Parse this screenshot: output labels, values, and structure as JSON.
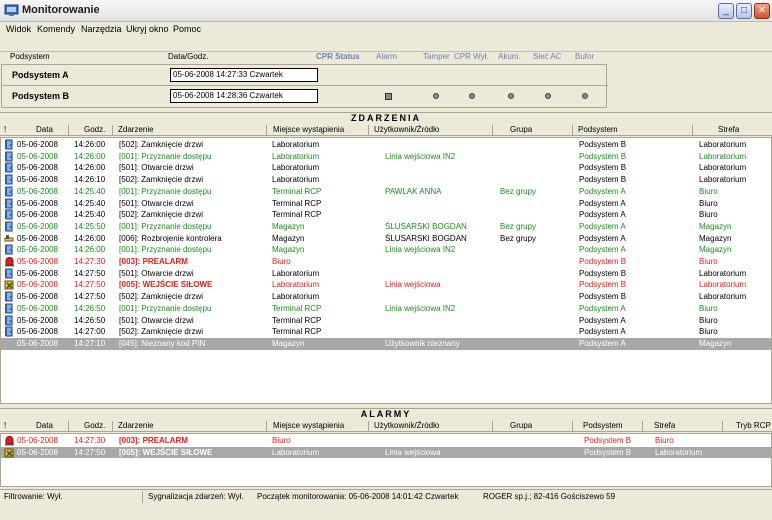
{
  "window": {
    "title": "Monitorowanie",
    "buttons": {
      "minimize": "_",
      "maximize": "□",
      "close": "✕"
    }
  },
  "menu": [
    "Widok",
    "Komendy",
    "Narzędzia",
    "Ukryj okno",
    "Pomoc"
  ],
  "status_header": {
    "podsystem": "Podsystem",
    "datagodz": "Data/Godz.",
    "cpr_status": "CPR Status",
    "alarm": "Alarm",
    "tamper": "Tamper",
    "cpr_wyl": "CPR Wył.",
    "akum": "Akum.",
    "siec_ac": "Sieć AC",
    "bufor": "Bufor"
  },
  "subsystems": [
    {
      "name": "Podsystem A",
      "datetime": "05-06-2008  14:27:33  Czwartek",
      "indicators": false
    },
    {
      "name": "Podsystem B",
      "datetime": "05-06-2008  14:28:36  Czwartek",
      "indicators": true
    }
  ],
  "events": {
    "title": "ZDARZENIA",
    "columns": [
      "Data",
      "Godz.",
      "Zdarzenie",
      "Miejsce wystąpienia",
      "Użytkownik/Źródło",
      "Grupa",
      "Podsystem",
      "Strefa"
    ],
    "colors": {
      "green": "#1e8a1e",
      "red": "#e41b1b",
      "black": "#000000"
    },
    "rows": [
      {
        "icon": "door-icon",
        "color": "black",
        "d": "05-06-2008",
        "t": "14:26:00",
        "e": "[502]: Zamknięcie drzwi",
        "m": "Laboratorium",
        "u": "",
        "g": "",
        "p": "Podsystem B",
        "s": "Laboratorium"
      },
      {
        "icon": "door-icon",
        "color": "green",
        "d": "05-06-2008",
        "t": "14:26:00",
        "e": "[001]: Przyznanie dostępu",
        "m": "Laboratorium",
        "u": "Linia wejściowa IN2",
        "g": "",
        "p": "Podsystem B",
        "s": "Laboratorium"
      },
      {
        "icon": "door-icon",
        "color": "black",
        "d": "05-06-2008",
        "t": "14:26:00",
        "e": "[501]: Otwarcie drzwi",
        "m": "Laboratorium",
        "u": "",
        "g": "",
        "p": "Podsystem B",
        "s": "Laboratorium"
      },
      {
        "icon": "door-icon",
        "color": "black",
        "d": "05-06-2008",
        "t": "14:26:10",
        "e": "[502]: Zamknięcie drzwi",
        "m": "Laboratorium",
        "u": "",
        "g": "",
        "p": "Podsystem B",
        "s": "Laboratorium"
      },
      {
        "icon": "door-icon",
        "color": "green",
        "d": "05-06-2008",
        "t": "14:25:40",
        "e": "[001]: Przyznanie dostępu",
        "m": "Terminal RCP",
        "u": "PAWLAK ANNA",
        "g": "Bez grupy",
        "p": "Podsystem A",
        "s": "Biuro"
      },
      {
        "icon": "door-icon",
        "color": "black",
        "d": "05-06-2008",
        "t": "14:25:40",
        "e": "[501]: Otwarcie drzwi",
        "m": "Terminal RCP",
        "u": "",
        "g": "",
        "p": "Podsystem A",
        "s": "Biuro"
      },
      {
        "icon": "door-icon",
        "color": "black",
        "d": "05-06-2008",
        "t": "14:25:40",
        "e": "[502]: Zamknięcie drzwi",
        "m": "Terminal RCP",
        "u": "",
        "g": "",
        "p": "Podsystem A",
        "s": "Biuro"
      },
      {
        "icon": "door-icon",
        "color": "green",
        "d": "05-06-2008",
        "t": "14:25:50",
        "e": "[001]: Przyznanie dostępu",
        "m": "Magazyn",
        "u": "ŚLUSARSKI BOGDAN",
        "g": "Bez grupy",
        "p": "Podsystem A",
        "s": "Magazyn"
      },
      {
        "icon": "key-icon",
        "color": "black",
        "d": "05-06-2008",
        "t": "14:26:00",
        "e": "[006]: Rozbrojenie kontrolera",
        "m": "Magazyn",
        "u": "ŚLUSARSKI BOGDAN",
        "g": "Bez grupy",
        "p": "Podsystem A",
        "s": "Magazyn"
      },
      {
        "icon": "door-icon",
        "color": "green",
        "d": "05-06-2008",
        "t": "14:26:00",
        "e": "[001]: Przyznanie dostępu",
        "m": "Magazyn",
        "u": "Linia wejściowa IN2",
        "g": "",
        "p": "Podsystem A",
        "s": "Magazyn"
      },
      {
        "icon": "siren-icon",
        "color": "red",
        "bold": true,
        "d": "05-06-2008",
        "t": "14:27:30",
        "e": "[003]: PREALARM",
        "m": "Biuro",
        "u": "",
        "g": "",
        "p": "Podsystem B",
        "s": "Biuro"
      },
      {
        "icon": "door-icon",
        "color": "black",
        "d": "05-06-2008",
        "t": "14:27:50",
        "e": "[501]: Otwarcie drzwi",
        "m": "Laboratorium",
        "u": "",
        "g": "",
        "p": "Podsystem B",
        "s": "Laboratorium"
      },
      {
        "icon": "break-in-icon",
        "color": "red",
        "bold": true,
        "d": "05-06-2008",
        "t": "14:27:50",
        "e": "[005]: WEJŚCIE SIŁOWE",
        "m": "Laboratorium",
        "u": "Linia wejściowa",
        "g": "",
        "p": "Podsystem B",
        "s": "Laboratorium"
      },
      {
        "icon": "door-icon",
        "color": "black",
        "d": "05-06-2008",
        "t": "14:27:50",
        "e": "[502]: Zamknięcie drzwi",
        "m": "Laboratorium",
        "u": "",
        "g": "",
        "p": "Podsystem B",
        "s": "Laboratorium"
      },
      {
        "icon": "door-icon",
        "color": "green",
        "d": "05-06-2008",
        "t": "14:26:50",
        "e": "[001]: Przyznanie dostępu",
        "m": "Terminal RCP",
        "u": "Linia wejściowa IN2",
        "g": "",
        "p": "Podsystem A",
        "s": "Biuro"
      },
      {
        "icon": "door-icon",
        "color": "black",
        "d": "05-06-2008",
        "t": "14:26:50",
        "e": "[501]: Otwarcie drzwi",
        "m": "Terminal RCP",
        "u": "",
        "g": "",
        "p": "Podsystem A",
        "s": "Biuro"
      },
      {
        "icon": "door-icon",
        "color": "black",
        "d": "05-06-2008",
        "t": "14:27:00",
        "e": "[502]: Zamknięcie drzwi",
        "m": "Terminal RCP",
        "u": "",
        "g": "",
        "p": "Podsystem A",
        "s": "Biuro"
      },
      {
        "icon": "",
        "color": "white",
        "selected": true,
        "d": "05-06-2008",
        "t": "14:27:10",
        "e": "[045]: Nieznany kod PIN",
        "m": "Magazyn",
        "u": "Użytkownik nieznany",
        "g": "",
        "p": "Podsystem A",
        "s": "Magazyn"
      }
    ]
  },
  "alarms": {
    "title": "ALARMY",
    "columns": [
      "Data",
      "Godz.",
      "Zdarzenie",
      "Miejsce wystąpienia",
      "Użytkownik/Źródło",
      "Grupa",
      "Podsystem",
      "Strefa",
      "Tryb RCP"
    ],
    "rows": [
      {
        "icon": "siren-icon",
        "color": "red",
        "bold": true,
        "d": "05-06-2008",
        "t": "14:27:30",
        "e": "[003]: PREALARM",
        "m": "Biuro",
        "u": "",
        "g": "",
        "p": "Podsystem B",
        "s": "Biuro"
      },
      {
        "icon": "break-in-icon",
        "color": "white",
        "bold": true,
        "selected": true,
        "d": "05-06-2008",
        "t": "14:27:50",
        "e": "[005]: WEJŚCIE SIŁOWE",
        "m": "Laboratorium",
        "u": "Linia wejściowa",
        "g": "",
        "p": "Podsystem B",
        "s": "Laboratorium"
      }
    ]
  },
  "statusbar": {
    "filter": "Filtrowanie: Wył.",
    "signal": "Sygnalizacja zdarzeń: Wył.",
    "start": "Początek monitorowania: 05-06-2008  14:01:42  Czwartek",
    "company": "ROGER sp.j.; 82-416 Gościszewo 59"
  }
}
